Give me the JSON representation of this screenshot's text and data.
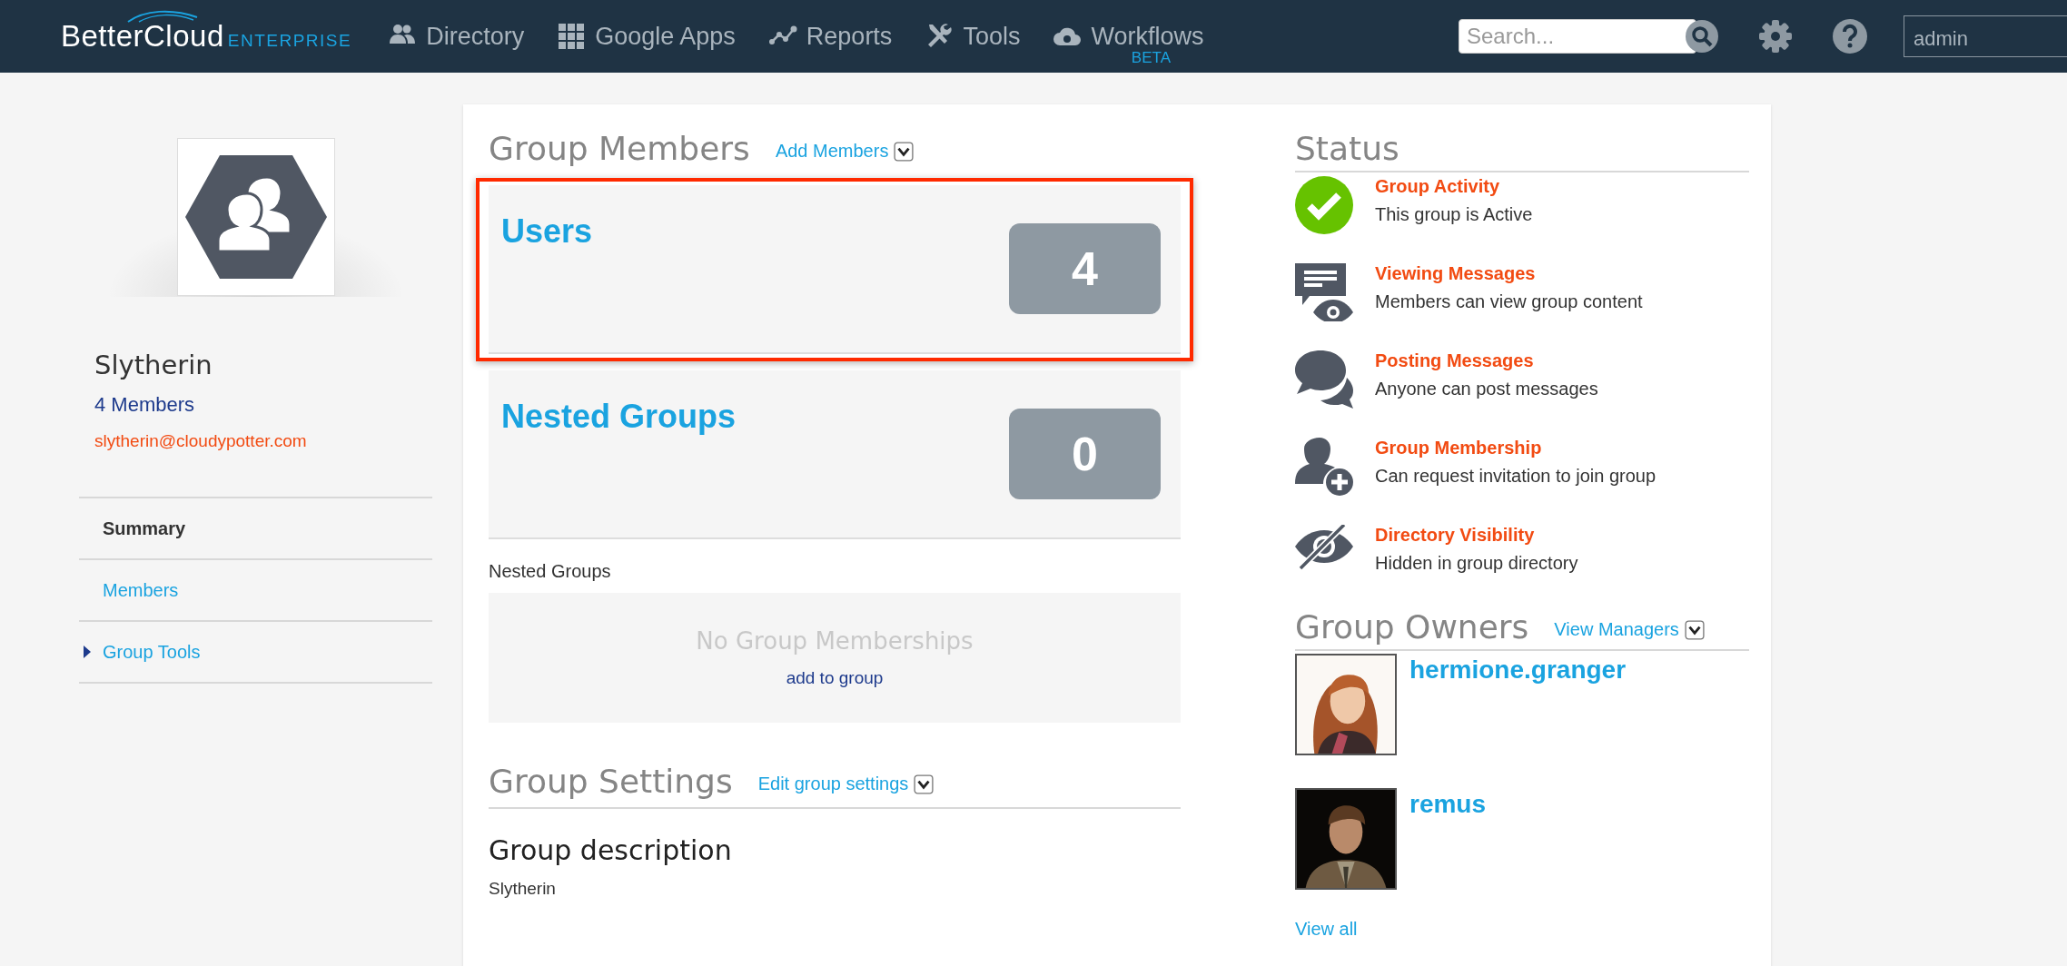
{
  "nav": {
    "logo": "BetterCloud",
    "logo_suffix": "ENTERPRISE",
    "items": [
      {
        "label": "Directory"
      },
      {
        "label": "Google Apps"
      },
      {
        "label": "Reports"
      },
      {
        "label": "Tools"
      },
      {
        "label": "Workflows",
        "badge": "BETA"
      }
    ],
    "search": {
      "placeholder": "Search..."
    },
    "user": "admin"
  },
  "sidebar": {
    "group_name": "Slytherin",
    "member_count": "4 Members",
    "email": "slytherin@cloudypotter.com",
    "items": [
      {
        "label": "Summary",
        "selected": true,
        "kind": "link"
      },
      {
        "label": "Members",
        "selected": false,
        "kind": "link"
      },
      {
        "label": "Group Tools",
        "selected": false,
        "kind": "toggle"
      }
    ]
  },
  "members": {
    "title": "Group Members",
    "action": "Add Members",
    "tiles": [
      {
        "label": "Users",
        "count": "4",
        "highlighted": true
      },
      {
        "label": "Nested Groups",
        "count": "0",
        "highlighted": false
      }
    ]
  },
  "nested_groups": {
    "label": "Nested Groups",
    "empty_text": "No Group Memberships",
    "action": "add to group"
  },
  "settings": {
    "title": "Group Settings",
    "action": "Edit group settings",
    "subtitle": "Group description",
    "description": "Slytherin"
  },
  "status": {
    "title": "Status",
    "items": [
      {
        "title": "Group Activity",
        "text": "This group is Active"
      },
      {
        "title": "Viewing Messages",
        "text": "Members can view group content"
      },
      {
        "title": "Posting Messages",
        "text": "Anyone can post messages"
      },
      {
        "title": "Group Membership",
        "text": "Can request invitation to join group"
      },
      {
        "title": "Directory Visibility",
        "text": "Hidden in group directory"
      }
    ]
  },
  "owners": {
    "title": "Group Owners",
    "action": "View Managers",
    "items": [
      {
        "name": "hermione.granger"
      },
      {
        "name": "remus"
      }
    ],
    "view_all": "View all"
  }
}
